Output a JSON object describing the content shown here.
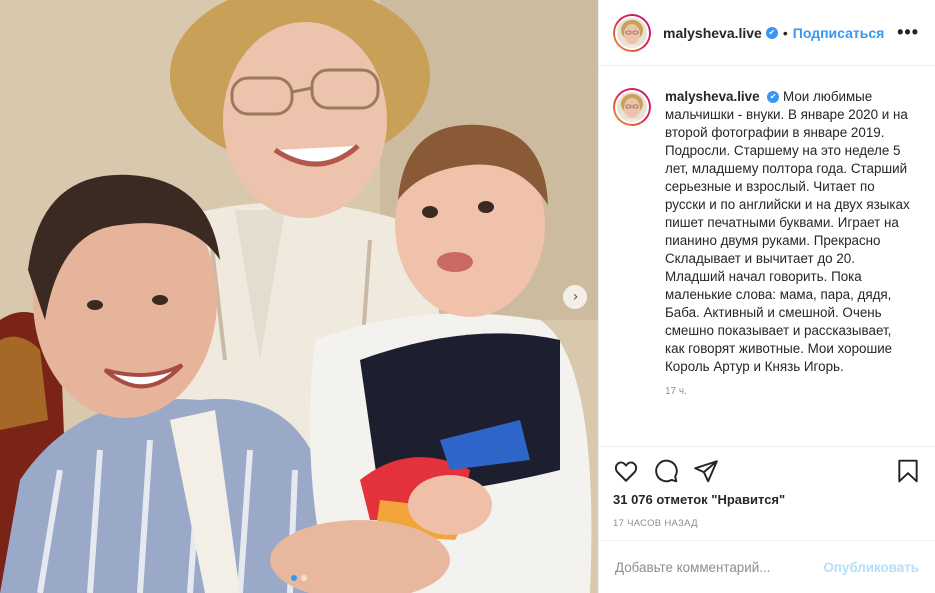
{
  "post": {
    "username": "malysheva.live",
    "verified_mark": "✔",
    "separator": "•",
    "follow_label": "Подписаться",
    "more_label": "•••",
    "caption": "Мои любимые мальчишки - внуки. В январе 2020 и на второй фотографии в январе 2019. Подросли. Старшему на это неделе 5 лет, младшему полтора года. Старший серьезные и взрослый. Читает по русски и по английски и на двух языках пишет печатными буквами. Играет на пианино двумя руками. Прекрасно Складывает и вычитает до 20. Младший начал говорить. Пока маленькие слова: мама, пара, дядя, Баба. Активный и смешной. Очень смешно показывает и рассказывает, как говорят животные. Мои хорошие Король Артур и Князь Игорь.",
    "caption_time": "17 ч.",
    "likes_text": "31 076 отметок \"Нравится\"",
    "time_ago": "17 часов назад"
  },
  "carousel": {
    "next_icon": "chevron-right-icon",
    "next_glyph": "›",
    "slides": 2,
    "active_slide": 1
  },
  "actions": {
    "icons": [
      "heart-icon",
      "comment-icon",
      "share-icon",
      "bookmark-icon"
    ]
  },
  "comment_box": {
    "placeholder": "Добавьте комментарий...",
    "publish_label": "Опубликовать"
  },
  "colors": {
    "accent": "#3897f0",
    "publish_disabled": "#b2dffc",
    "muted": "#8e8e8e",
    "border": "#efefef"
  }
}
